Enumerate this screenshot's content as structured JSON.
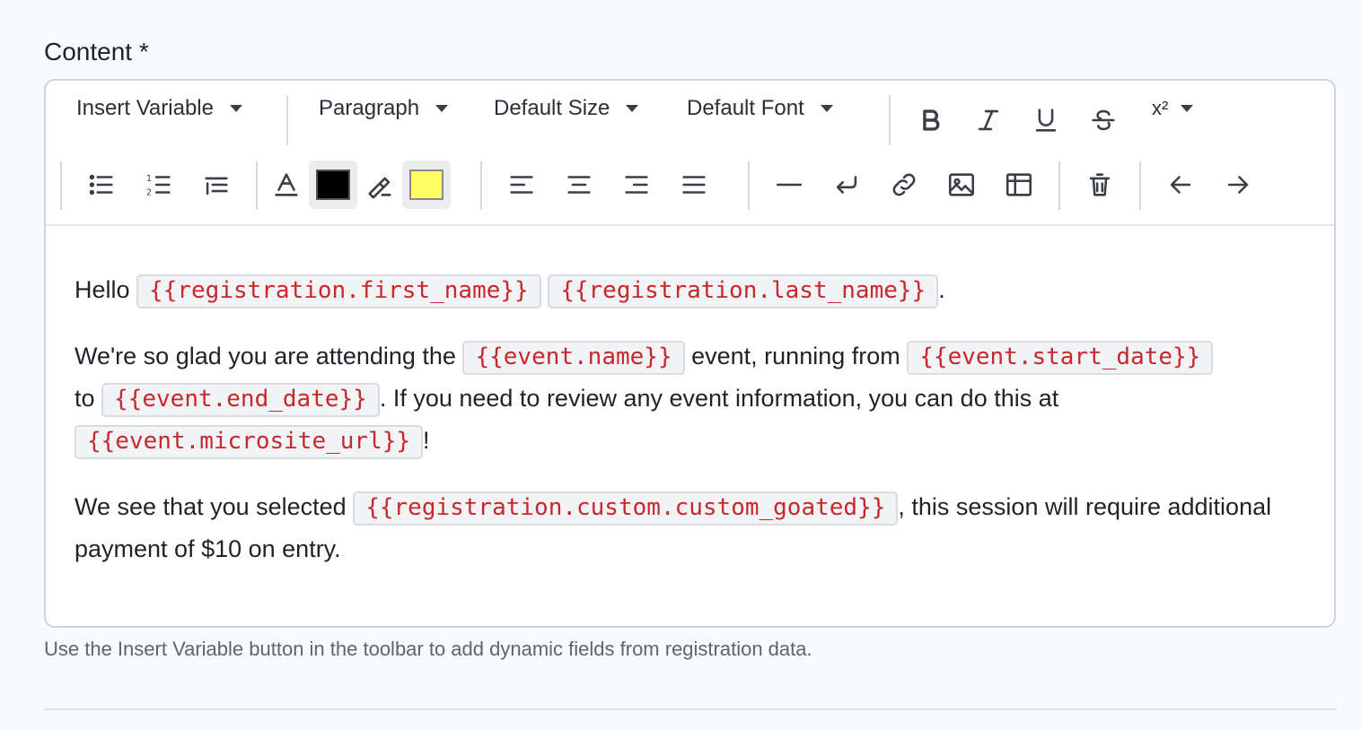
{
  "field": {
    "label": "Content *"
  },
  "toolbar": {
    "insert_variable": "Insert Variable",
    "block_format": "Paragraph",
    "font_size": "Default Size",
    "font_family": "Default Font",
    "superscript_label": "x²",
    "text_color": "#000000",
    "highlight_color": "#ffff66"
  },
  "content": {
    "p1": {
      "greeting": "Hello",
      "var1": "{{registration.first_name}}",
      "var2": "{{registration.last_name}}",
      "end": "."
    },
    "p2": {
      "t1": "We're so glad you are attending the",
      "var_name": "{{event.name}}",
      "t2": "event, running from",
      "var_start": "{{event.start_date}}",
      "t3": "to",
      "var_end": "{{event.end_date}}",
      "t4": ". If you need to review any event information, you can do this at",
      "var_url": "{{event.microsite_url}}",
      "t5": "!"
    },
    "p3": {
      "t1": "We see that you selected",
      "var_custom": "{{registration.custom.custom_goated}}",
      "t2": ", this session will require additional payment of $10 on entry."
    }
  },
  "help_text": "Use the Insert Variable button in the toolbar to add dynamic fields from registration data.",
  "colors": {
    "variable_text": "#c6282e",
    "variable_bg": "#f2f3f5"
  }
}
